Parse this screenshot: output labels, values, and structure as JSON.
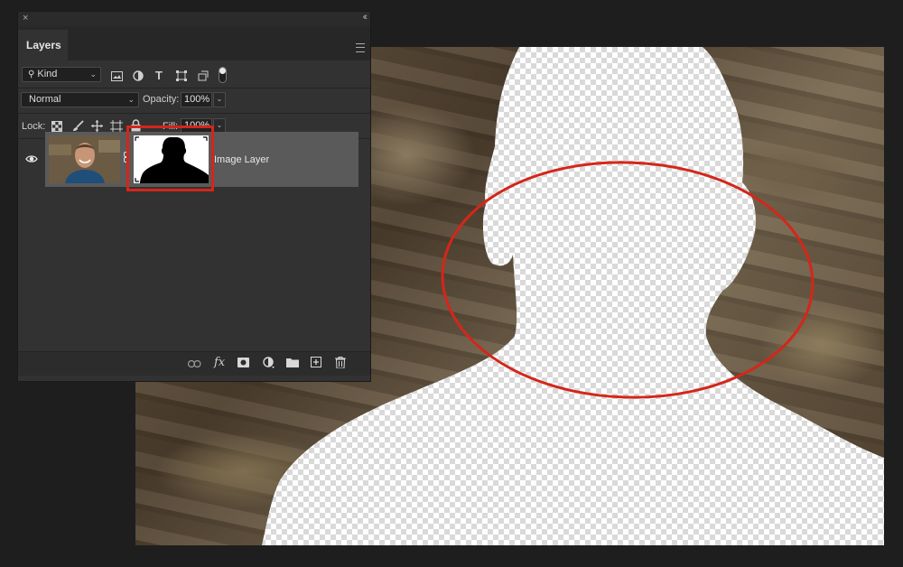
{
  "panel": {
    "close_glyph": "×",
    "collapse_glyph": "‹‹",
    "tab_label": "Layers",
    "filter": {
      "kind_label": "Kind",
      "icons": [
        "pixel-filter-icon",
        "adjustment-filter-icon",
        "type-filter-icon",
        "shape-filter-icon",
        "smart-object-filter-icon",
        "filter-toggle-icon"
      ]
    },
    "blend_mode": "Normal",
    "opacity_label": "Opacity:",
    "opacity_value": "100%",
    "lock_label": "Lock:",
    "lock_icons": [
      "lock-transparency-icon",
      "lock-pixels-icon",
      "lock-position-icon",
      "lock-artboard-icon",
      "lock-all-icon"
    ],
    "fill_label": "Fill:",
    "fill_value": "100%",
    "layer": {
      "name": "Image Layer",
      "visible": true,
      "has_mask": true,
      "mask_highlight_color": "#d4261a"
    },
    "bottom_icons": [
      "link-layers-icon",
      "fx-icon",
      "add-mask-icon",
      "adjustment-layer-icon",
      "group-folder-icon",
      "new-layer-icon",
      "trash-icon"
    ],
    "fx_label": "fx"
  },
  "canvas": {
    "annotation_color": "#d4261a"
  }
}
